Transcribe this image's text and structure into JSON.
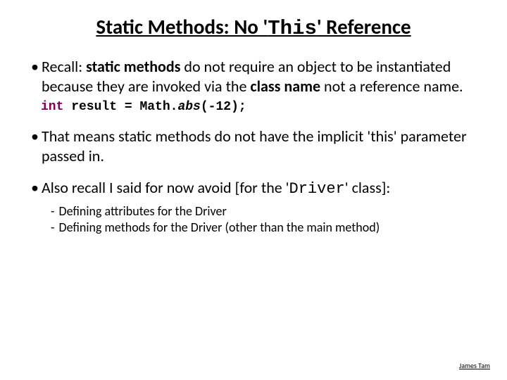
{
  "title": {
    "pre": "Static Methods: No '",
    "mono": "This",
    "post": "' Reference"
  },
  "bullets": {
    "b1": {
      "p1": "Recall: ",
      "bold1": "static methods",
      "p2": " do not require an object to be instantiated because they are invoked via the ",
      "bold2": "class name",
      "p3": " not a reference name."
    },
    "code": {
      "kw": "int",
      "var": " result = ",
      "cls": "Math.",
      "method": "abs",
      "args": "(-12);"
    },
    "b2": "That means static methods do not have the implicit 'this' parameter passed in.",
    "b3": {
      "p1": "Also recall I said for now avoid [for the '",
      "mono": "Driver",
      "p2": "' class]:"
    },
    "sub1": "Defining attributes for the Driver",
    "sub2": "Defining methods for the Driver (other than the main method)"
  },
  "footer": "James Tam"
}
